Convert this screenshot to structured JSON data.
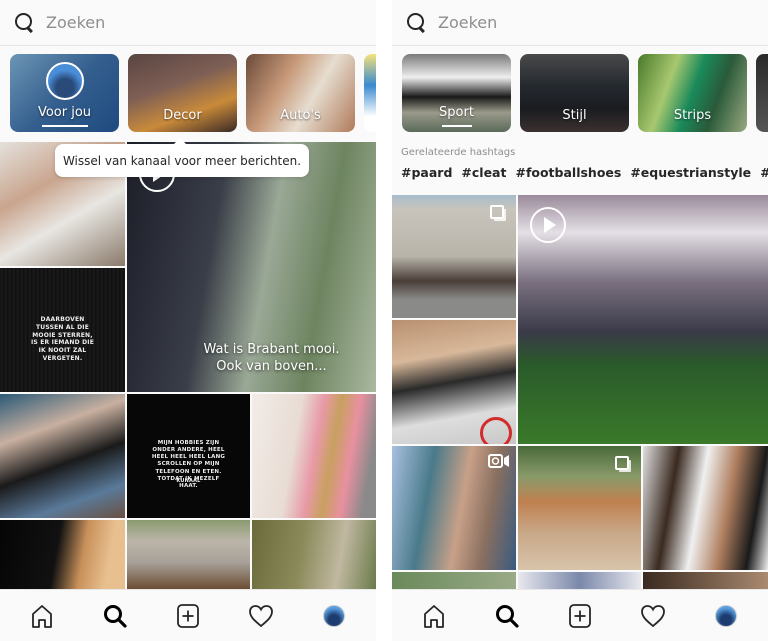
{
  "left": {
    "search": {
      "placeholder": "Zoeken",
      "icon": "search-icon"
    },
    "channels": [
      {
        "label": "Voor jou",
        "selected": true
      },
      {
        "label": "Decor",
        "selected": false
      },
      {
        "label": "Auto's",
        "selected": false
      }
    ],
    "tooltip": "Wissel van kanaal voor meer berichten.",
    "tiles": {
      "quote1": "DAARBOVEN TUSSEN AL DIE MOOIE STERREN, IS ER IEMAND DIE IK NOOIT ZAL VERGETEN.",
      "video_caption_line1": "Wat is Brabant mooi.",
      "video_caption_line2": "Ook van boven...",
      "quote2": "MIJN HOBBIES ZIJN ONDER ANDERE, HEEL HEEL HEEL HEEL LANG SCROLLEN OP MIJN TELEFOON EN ETEN. TOTDAT IK MEZELF HAAT.",
      "quote2_author": "KUNAAL"
    }
  },
  "right": {
    "search": {
      "placeholder": "Zoeken",
      "icon": "search-icon"
    },
    "channels": [
      {
        "label": "Sport",
        "selected": true
      },
      {
        "label": "Stijl",
        "selected": false
      },
      {
        "label": "Strips",
        "selected": false
      }
    ],
    "related_title": "Gerelateerde hashtags",
    "hashtags": [
      "#paard",
      "#cleat",
      "#footballshoes",
      "#equestrianstyle",
      "#juventuss"
    ]
  },
  "nav": {
    "items": [
      {
        "name": "home",
        "icon": "home-icon"
      },
      {
        "name": "search",
        "icon": "search-icon",
        "active": true
      },
      {
        "name": "new-post",
        "icon": "plus-square-icon"
      },
      {
        "name": "activity",
        "icon": "heart-icon"
      },
      {
        "name": "profile",
        "icon": "avatar"
      }
    ]
  },
  "colors": {
    "background": "#fafafa",
    "text_primary": "#262626",
    "text_secondary": "#8e8e8e",
    "highlight_red": "#d32a2a"
  }
}
